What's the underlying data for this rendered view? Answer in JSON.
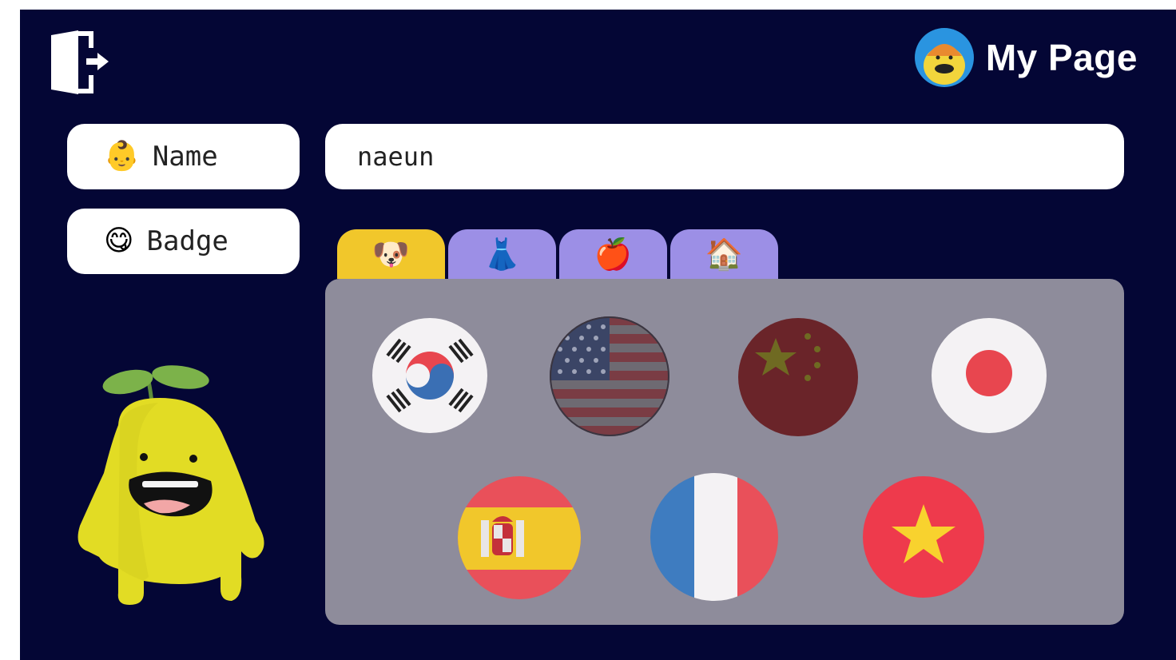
{
  "header": {
    "title": "My Page",
    "logout_icon": "logout-door-icon",
    "avatar_icon": "user-avatar-icon"
  },
  "profile": {
    "name_label": "Name",
    "name_emoji": "👶",
    "name_value": "naeun",
    "badge_label": "Badge",
    "badge_emoji": "😋"
  },
  "tabs": [
    {
      "icon": "dog-face-icon",
      "emoji": "🐶",
      "active": true
    },
    {
      "icon": "dress-icon",
      "emoji": "👗",
      "active": false
    },
    {
      "icon": "apple-icon",
      "emoji": "🍎",
      "active": false
    },
    {
      "icon": "house-icon",
      "emoji": "🏠",
      "active": false
    }
  ],
  "badges": [
    {
      "icon": "south-korea-flag-icon",
      "country": "South Korea"
    },
    {
      "icon": "usa-flag-icon",
      "country": "United States"
    },
    {
      "icon": "china-flag-icon",
      "country": "China"
    },
    {
      "icon": "japan-flag-icon",
      "country": "Japan"
    },
    {
      "icon": "spain-flag-icon",
      "country": "Spain"
    },
    {
      "icon": "france-flag-icon",
      "country": "France"
    },
    {
      "icon": "vietnam-flag-icon",
      "country": "Vietnam"
    }
  ],
  "colors": {
    "background": "#040635",
    "active_tab": "#f1c72b",
    "inactive_tab": "#9c8fe6",
    "panel": "#8e8c9b",
    "pill": "#ffffff"
  }
}
